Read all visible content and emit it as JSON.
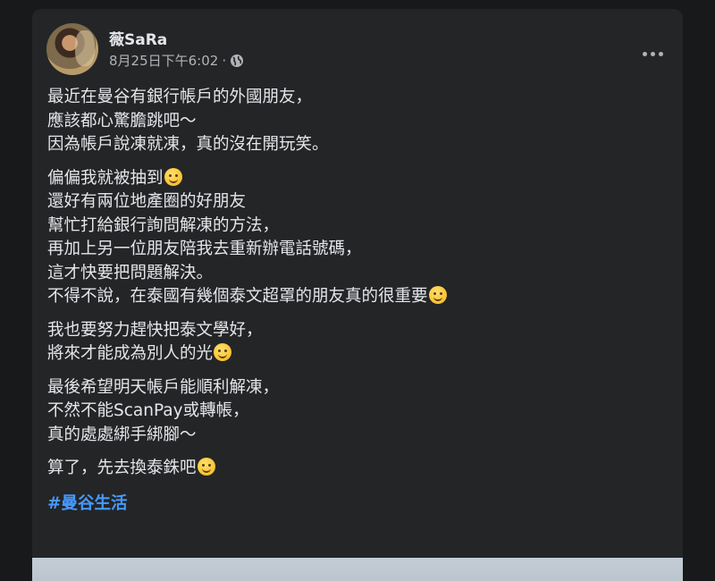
{
  "post": {
    "author": "薇SaRa",
    "timestamp": "8月25日下午6:02",
    "separator": "·",
    "privacy_icon": "globe-icon",
    "paragraphs": [
      [
        "最近在曼谷有銀行帳戶的外國朋友，",
        "應該都心驚膽跳吧～",
        "因為帳戶說凍就凍，真的沒在開玩笑。"
      ],
      [
        "偏偏我就被抽到",
        "還好有兩位地產圈的好朋友",
        "幫忙打給銀行詢問解凍的方法，",
        "再加上另一位朋友陪我去重新辦電話號碼，",
        "這才快要把問題解決。",
        "不得不說，在泰國有幾個泰文超罩的朋友真的很重要"
      ],
      [
        "我也要努力趕快把泰文學好，",
        "將來才能成為別人的光"
      ],
      [
        "最後希望明天帳戶能順利解凍，",
        "不然不能ScanPay或轉帳，",
        "真的處處綁手綁腳～"
      ],
      [
        "算了，先去換泰銖吧"
      ]
    ],
    "hashtag": "#曼谷生活",
    "emojis": [
      "grinning-sweat-emoji",
      "rolling-laughing-emoji",
      "hand-over-mouth-emoji",
      "weary-emoji"
    ]
  }
}
